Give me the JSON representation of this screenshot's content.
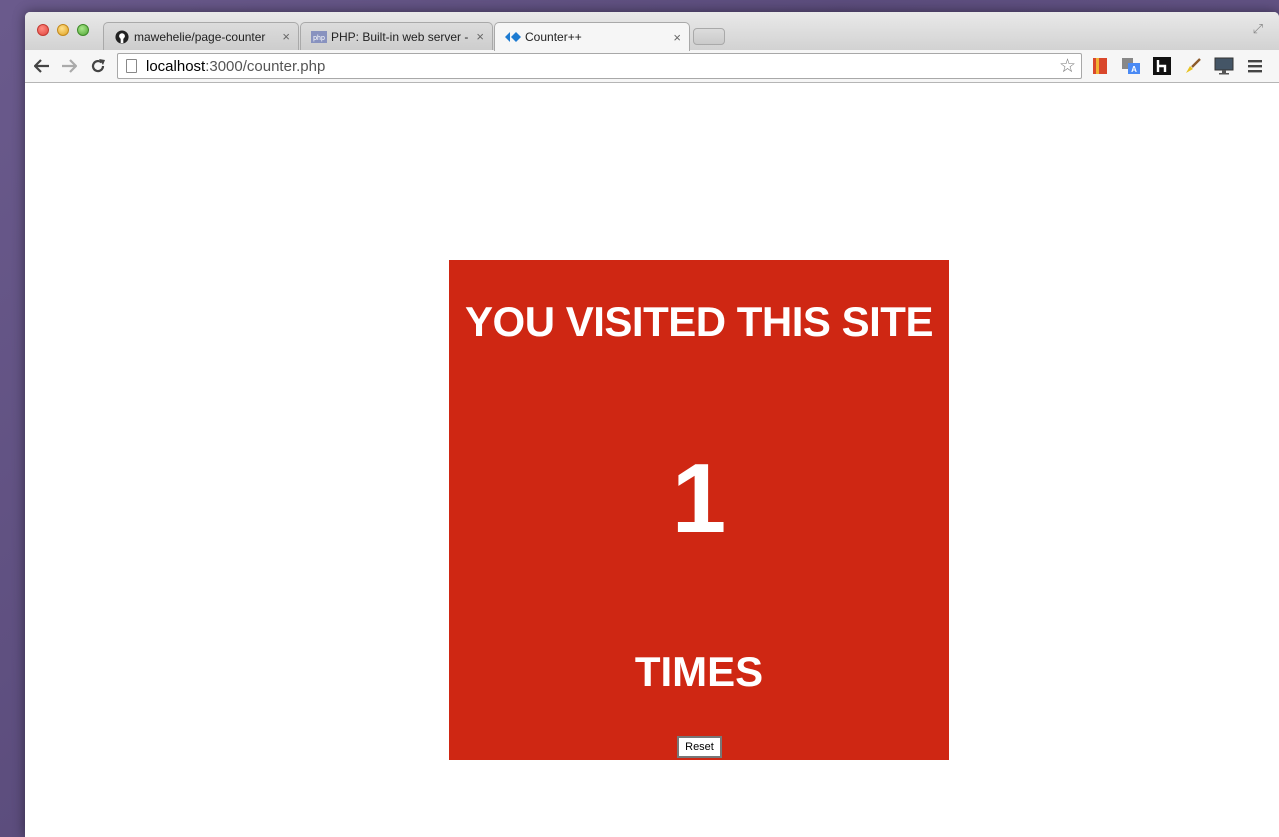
{
  "browser": {
    "tabs": [
      {
        "title": "mawehelie/page-counter",
        "favicon": "github-icon",
        "active": false
      },
      {
        "title": "PHP: Built-in web server -",
        "favicon": "php-icon",
        "active": false
      },
      {
        "title": "Counter++",
        "favicon": "counter-icon",
        "active": true
      }
    ],
    "tab_close_glyph": "×",
    "url_host": "localhost",
    "url_path": ":3000/counter.php"
  },
  "page": {
    "heading": "YOU VISITED THIS SITE",
    "count": "1",
    "unit": "TIMES",
    "reset_label": "Reset",
    "box_color": "#cf2713"
  }
}
